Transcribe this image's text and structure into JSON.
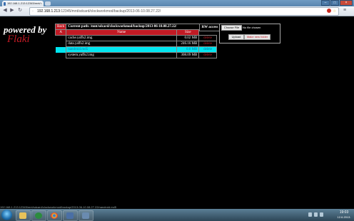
{
  "browser": {
    "tab_title": "192.168.1.213:12345/mnt/",
    "tab_close": "×",
    "url_host": "192.168.1.213",
    "url_rest": ":12345/mnt/sdcard/clockworkmod/backup/2013-06-10.08.27.22/",
    "star": "☆",
    "back": "◀",
    "forward": "▶",
    "reload": "↻",
    "wrench": "≡",
    "win_min": "–",
    "win_max": "□",
    "win_close": "×"
  },
  "logo": {
    "line1": "powered by",
    "line2": "Flaki"
  },
  "table": {
    "up_label": "Back",
    "path_label": "Current path: /mnt/sdcard/clockworkmod/backup/2013-06-10.08.27.22/",
    "sort_label": "A",
    "col_name": "Name",
    "col_size": "Size",
    "rw_label": "RW access",
    "rows": [
      {
        "name": "cache.yaffs2.img",
        "size": "0.02 MB",
        "action": "delete",
        "selected": false
      },
      {
        "name": "data.yaffs2.img",
        "size": "246.16 MB",
        "action": "delete",
        "selected": false
      },
      {
        "name": "nandroid.md5",
        "size": "0.0 MB",
        "action": "delete",
        "selected": true
      },
      {
        "name": "system.yaffs2.img",
        "size": "308.09 MB",
        "action": "delete",
        "selected": false
      }
    ]
  },
  "upload": {
    "choose_file": "Choose File",
    "no_file": "No file chosen",
    "upload_button": "Upload",
    "make_folder_button": "Make new folder"
  },
  "status_url": "192.168.1.213:12345/mnt/sdcard/clockworkmod/backup/2013-06-10.08.27.22/nandroid.md5",
  "taskbar": {
    "time": "19:03",
    "date": "12.6.2013."
  },
  "colors": {
    "accent_red": "#c11a24",
    "selected_row": "#00e6f0"
  }
}
